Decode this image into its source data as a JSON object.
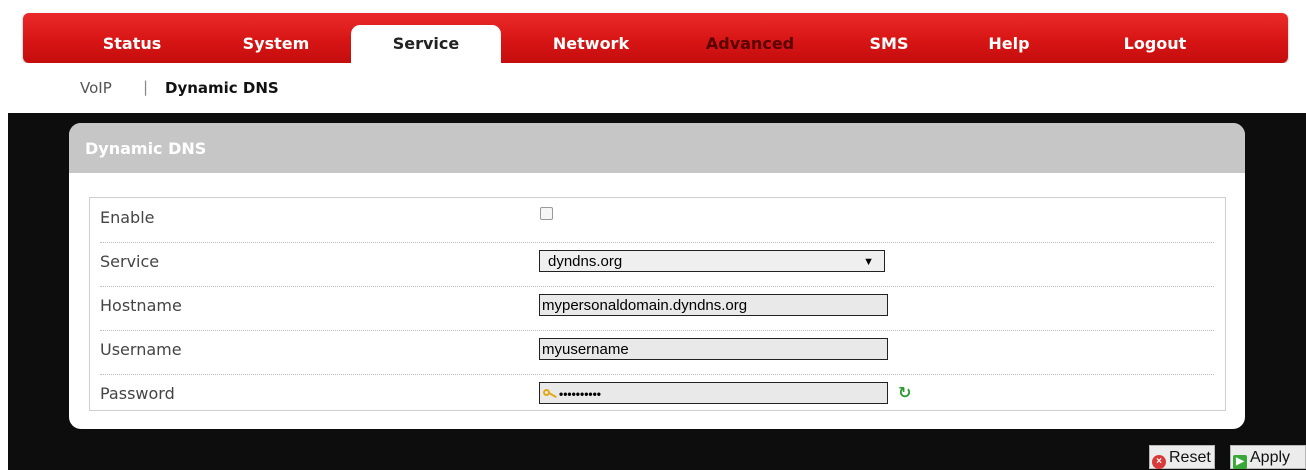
{
  "nav": {
    "items": [
      {
        "label": "Status"
      },
      {
        "label": "System"
      },
      {
        "label": "Service"
      },
      {
        "label": "Network"
      },
      {
        "label": "Advanced"
      },
      {
        "label": "SMS"
      },
      {
        "label": "Help"
      },
      {
        "label": "Logout"
      }
    ],
    "active": "Service"
  },
  "subnav": {
    "items": [
      {
        "label": "VoIP"
      },
      {
        "label": "Dynamic DNS"
      }
    ],
    "separator": "|",
    "active": "Dynamic DNS"
  },
  "panel": {
    "title": "Dynamic DNS"
  },
  "form": {
    "enable_label": "Enable",
    "enable_checked": false,
    "service_label": "Service",
    "service_value": "dyndns.org",
    "hostname_label": "Hostname",
    "hostname_value": "mypersonaldomain.dyndns.org",
    "username_label": "Username",
    "username_value": "myusername",
    "password_label": "Password",
    "password_mask": "••••••••••"
  },
  "actions": {
    "reset_label": "Reset",
    "apply_label": "Apply"
  },
  "colors": {
    "nav_red": "#d81515",
    "panel_header": "#c6c6c6",
    "content_bg": "#0d0d0d"
  }
}
